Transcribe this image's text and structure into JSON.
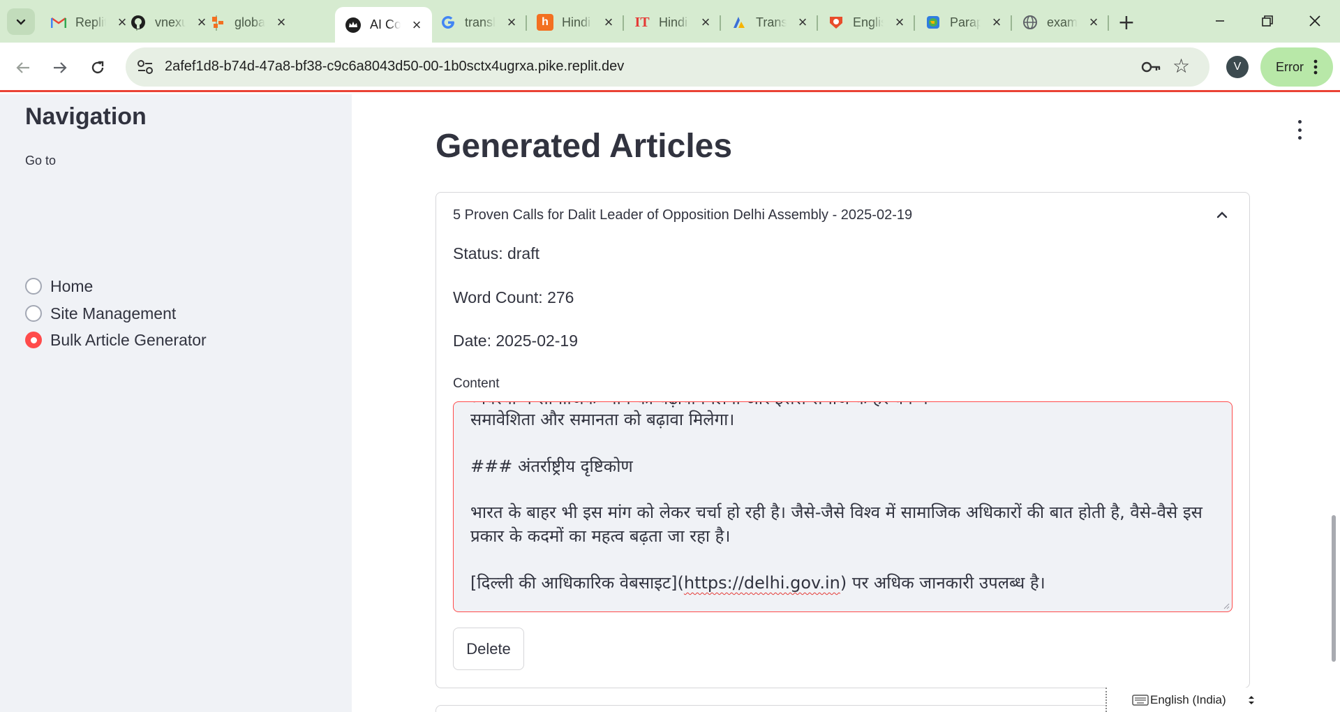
{
  "browser": {
    "tabs": [
      {
        "label": "Replit",
        "icon": "gmail-icon"
      },
      {
        "label": "vnexus",
        "icon": "github-icon"
      },
      {
        "label": "global",
        "icon": "globe-app-icon"
      },
      {
        "label": "AI Content",
        "icon": "ai-app-icon",
        "active": true
      },
      {
        "label": "translate",
        "icon": "google-icon"
      },
      {
        "label": "Hindi",
        "icon": "hindi-app-icon"
      },
      {
        "label": "Hindi",
        "icon": "it-icon"
      },
      {
        "label": "Translate",
        "icon": "translate-icon"
      },
      {
        "label": "English",
        "icon": "english-app-icon"
      },
      {
        "label": "Paraphrase",
        "icon": "paraphrase-icon"
      },
      {
        "label": "example",
        "icon": "globe-icon"
      }
    ],
    "url": "2afef1d8-b74d-47a8-bf38-c9c6a8043d50-00-1b0sctx4ugrxa.pike.replit.dev",
    "profile_initial": "V",
    "error_label": "Error"
  },
  "sidebar": {
    "title": "Navigation",
    "goto_label": "Go to",
    "options": [
      {
        "label": "Home",
        "selected": false
      },
      {
        "label": "Site Management",
        "selected": false
      },
      {
        "label": "Bulk Article Generator",
        "selected": true
      }
    ]
  },
  "main": {
    "heading": "Generated Articles",
    "article": {
      "title": "5 Proven Calls for Dalit Leader of Opposition Delhi Assembly - 2025-02-19",
      "status": "Status: draft",
      "word_count": "Word Count: 276",
      "date": "Date: 2025-02-19",
      "content_label": "Content",
      "content_lines": {
        "cut_top": "व्यवस्था में सामाजिक न्याय को बढ़ावा मिलेगा और इससे समाज के हर वर्ग में",
        "line1": "समावेशिता और समानता को बढ़ावा मिलेगा।",
        "heading": "### अंतर्राष्ट्रीय दृष्टिकोण",
        "para": "भारत के बाहर भी इस मांग को लेकर चर्चा हो रही है। जैसे-जैसे विश्व में सामाजिक अधिकारों की बात होती है, वैसे-वैसे इस प्रकार के कदमों का महत्व बढ़ता जा रहा है।",
        "link_text": "[दिल्ली की आधिकारिक वेबसाइट](",
        "link_url": "https://delhi.gov.in",
        "link_tail": ") पर अधिक जानकारी उपलब्ध है।"
      },
      "delete_label": "Delete"
    }
  },
  "input_method": {
    "label": "English (India)"
  },
  "colors": {
    "accent": "#ff4b4b",
    "sidebar_bg": "#f0f2f6",
    "chrome_bg": "#d6ebd0",
    "error_btn": "#b8e8a8"
  }
}
